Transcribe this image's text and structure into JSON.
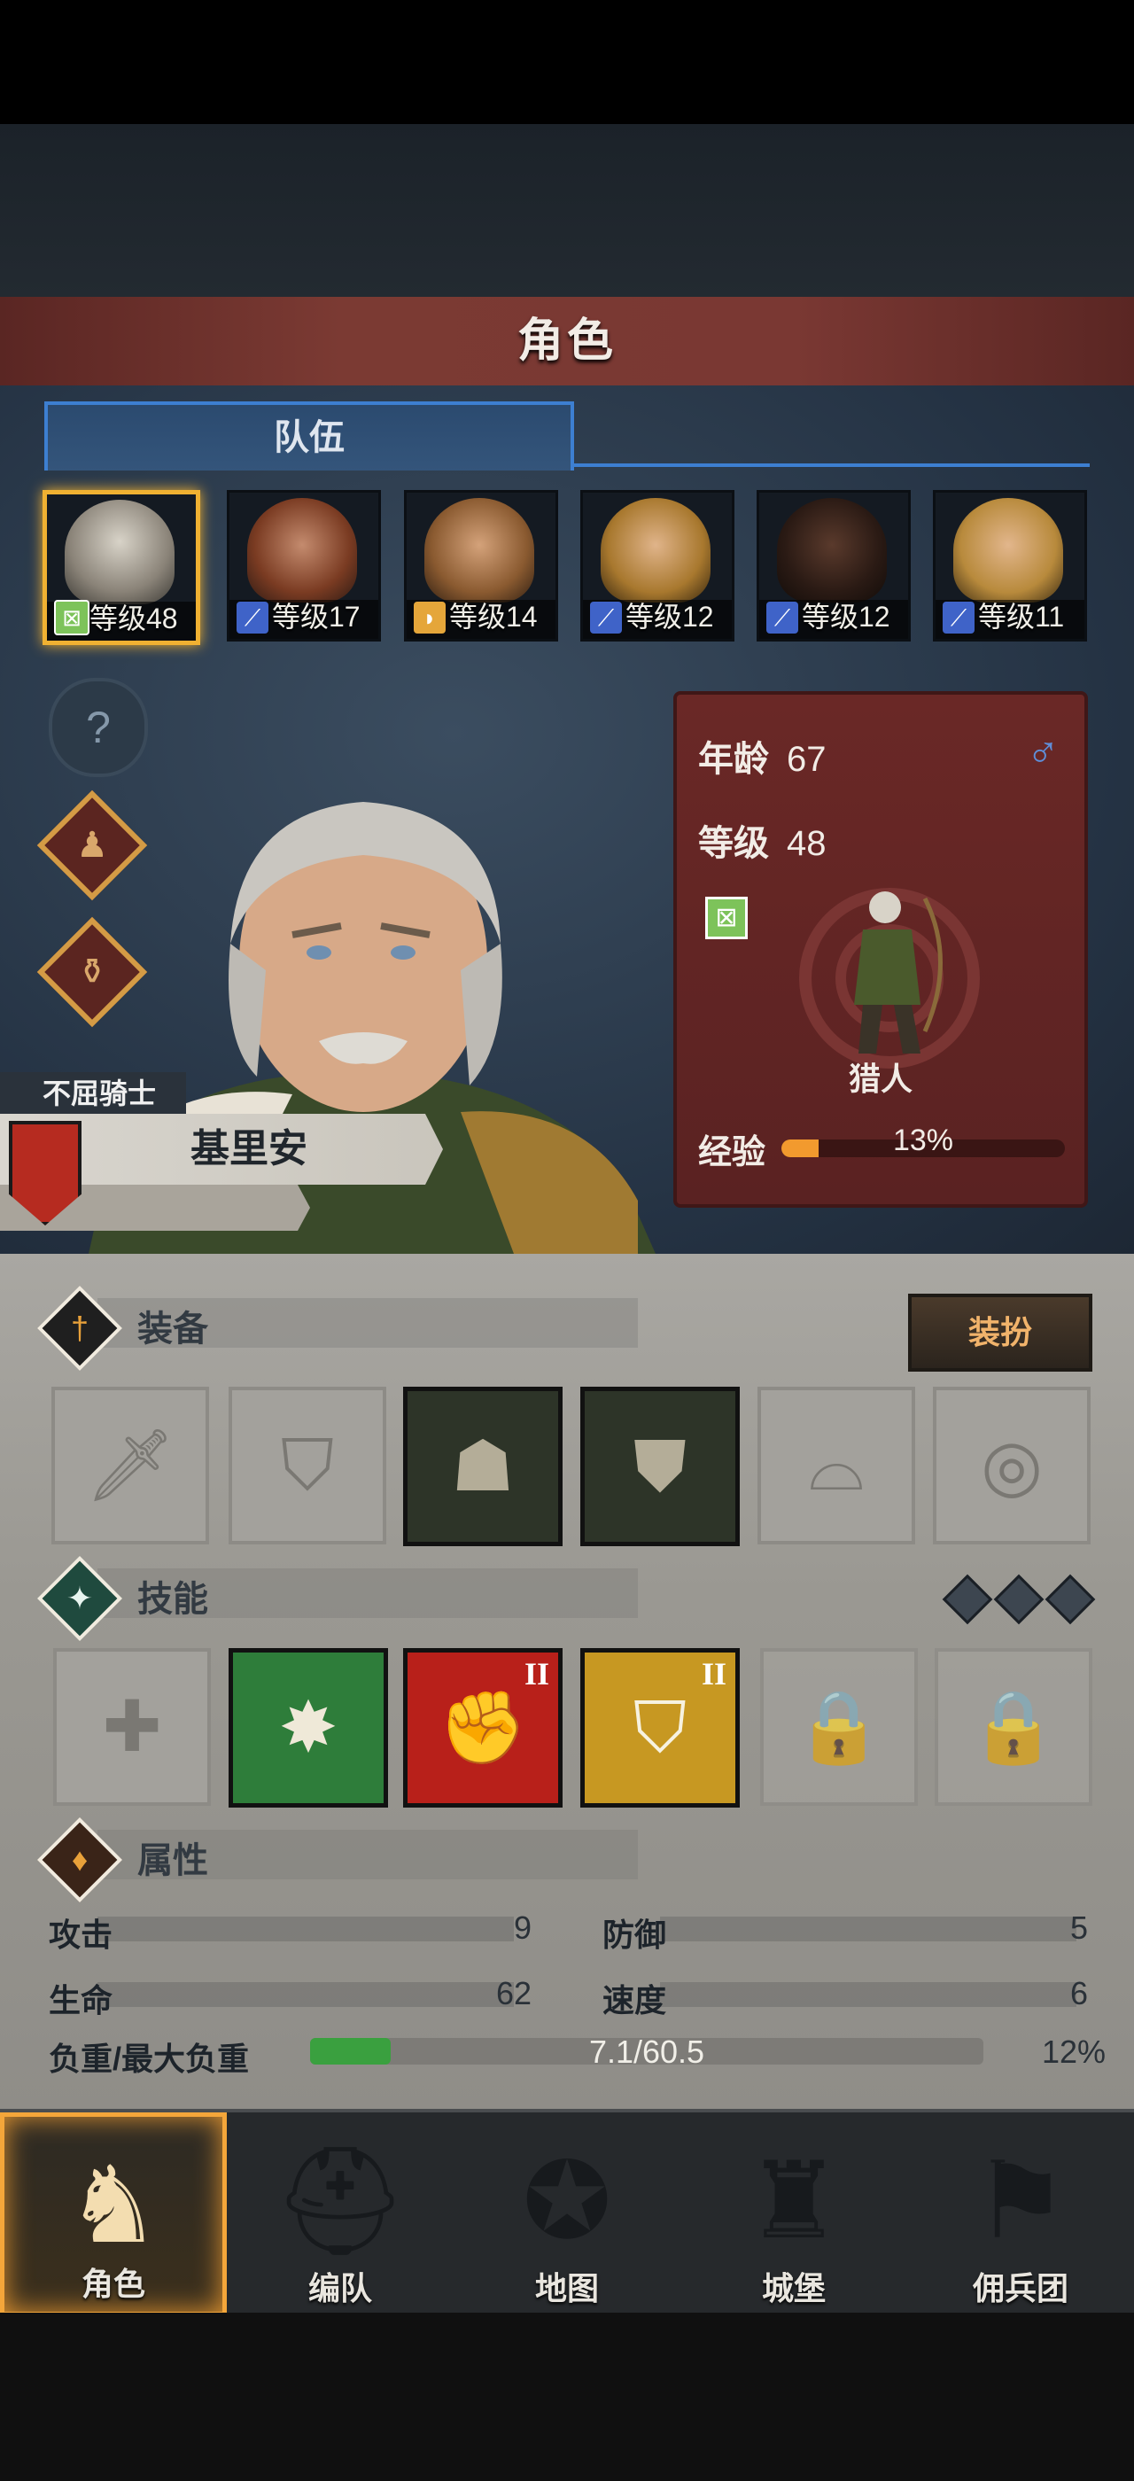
{
  "header": {
    "title": "角色"
  },
  "tabs": [
    {
      "label": "队伍",
      "active": true
    }
  ],
  "party": [
    {
      "level_label": "等级48",
      "class_icon": "ranger-icon",
      "selected": true
    },
    {
      "level_label": "等级17",
      "class_icon": "sword-icon",
      "selected": false
    },
    {
      "level_label": "等级14",
      "class_icon": "shield-icon",
      "selected": false
    },
    {
      "level_label": "等级12",
      "class_icon": "sword-icon",
      "selected": false
    },
    {
      "level_label": "等级12",
      "class_icon": "sword-icon",
      "selected": false
    },
    {
      "level_label": "等级11",
      "class_icon": "sword-icon",
      "selected": false
    }
  ],
  "side_buttons": [
    {
      "icon": "help-icon"
    },
    {
      "icon": "character-icon"
    },
    {
      "icon": "potion-icon"
    }
  ],
  "character": {
    "title": "不屈骑士",
    "name": "基里安",
    "age_label": "年龄",
    "age": "67",
    "gender_icon": "male-icon",
    "level_label": "等级",
    "level": "48",
    "class_name": "猎人",
    "exp_label": "经验",
    "exp_percent": "13%",
    "exp_fraction": 0.13
  },
  "equipment": {
    "title": "装备",
    "dress_button": "装扮",
    "slots": [
      {
        "icon": "weapon-slot-icon",
        "filled": false
      },
      {
        "icon": "shield-slot-icon",
        "filled": false
      },
      {
        "icon": "hood-icon",
        "filled": true
      },
      {
        "icon": "armor-icon",
        "filled": true
      },
      {
        "icon": "boots-slot-icon",
        "filled": false
      },
      {
        "icon": "ring-slot-icon",
        "filled": false
      }
    ]
  },
  "skills": {
    "title": "技能",
    "slots": [
      {
        "icon": "cross-icon",
        "state": "empty",
        "tier": ""
      },
      {
        "icon": "burst-arrow-icon",
        "state": "green",
        "tier": ""
      },
      {
        "icon": "smash-icon",
        "state": "red",
        "tier": "II"
      },
      {
        "icon": "shield-skill-icon",
        "state": "gold",
        "tier": "II"
      },
      {
        "icon": "lock-icon",
        "state": "locked",
        "tier": ""
      },
      {
        "icon": "lock-icon",
        "state": "locked",
        "tier": ""
      }
    ]
  },
  "attributes": {
    "title": "属性",
    "attack_label": "攻击",
    "attack": "9",
    "defense_label": "防御",
    "defense": "5",
    "hp_label": "生命",
    "hp": "62",
    "speed_label": "速度",
    "speed": "6",
    "load_label": "负重/最大负重",
    "load_value": "7.1/60.5",
    "load_percent": "12%",
    "load_fraction": 0.12
  },
  "nav": [
    {
      "label": "角色",
      "icon": "knight-icon",
      "active": true
    },
    {
      "label": "编队",
      "icon": "helmet-icon",
      "active": false
    },
    {
      "label": "地图",
      "icon": "compass-icon",
      "active": false
    },
    {
      "label": "城堡",
      "icon": "castle-icon",
      "active": false
    },
    {
      "label": "佣兵团",
      "icon": "banner-icon",
      "active": false
    }
  ],
  "colors": {
    "accent": "#f0b132",
    "tab_blue": "#3d7fd1",
    "title_red": "#7b3a33",
    "exp_orange": "#f29a2e",
    "load_green": "#3aa03f"
  }
}
